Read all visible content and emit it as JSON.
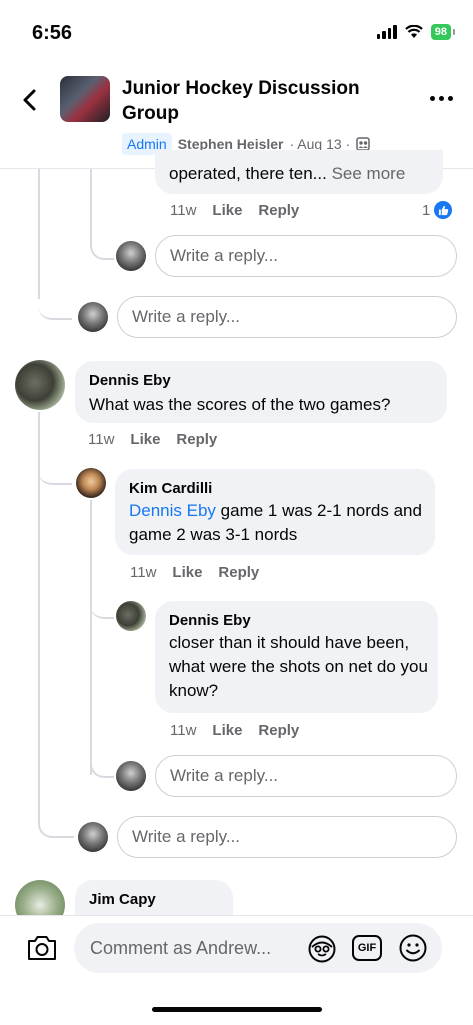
{
  "status_bar": {
    "time": "6:56",
    "battery": "98"
  },
  "header": {
    "title": "Junior Hockey Discussion Group",
    "admin_badge": "Admin",
    "author": "Stephen Heisler",
    "date": "· Aug 13 ·"
  },
  "thread_top": {
    "text": "operated, there ten...",
    "see_more": "See more",
    "time": "11w",
    "like": "Like",
    "reply": "Reply",
    "like_count": "1"
  },
  "reply_placeholder": "Write a reply...",
  "comments": [
    {
      "name": "Dennis Eby",
      "text": "What was the scores of the two games?",
      "time": "11w",
      "like": "Like",
      "reply": "Reply"
    },
    {
      "name": "Kim Cardilli",
      "mention": "Dennis Eby",
      "text": " game 1 was 2-1 nords and game 2 was 3-1 nords",
      "time": "11w",
      "like": "Like",
      "reply": "Reply"
    },
    {
      "name": "Dennis Eby",
      "text": "closer than it should have been, what were the shots on net do you know?",
      "time": "11w",
      "like": "Like",
      "reply": "Reply"
    },
    {
      "name": "Jim Capy"
    }
  ],
  "bottom": {
    "comment_placeholder": "Comment as Andrew...",
    "gif_label": "GIF"
  },
  "colors": {
    "accent": "#1877f2",
    "bubble": "#f0f2f5",
    "muted": "#65676b"
  }
}
